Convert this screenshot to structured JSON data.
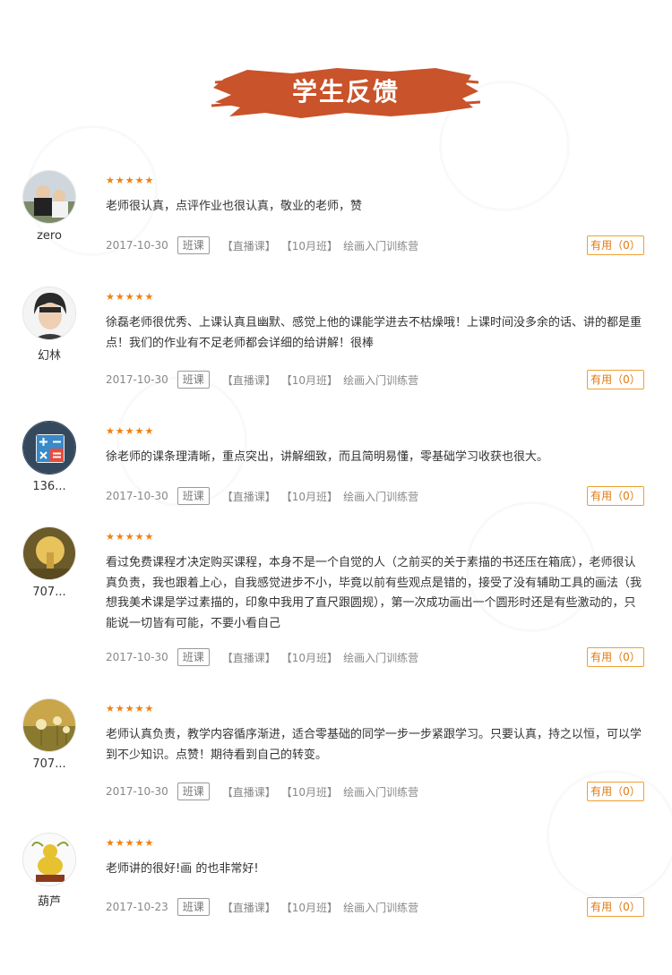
{
  "header": {
    "title": "学生反馈",
    "banner_color": "#c9532a"
  },
  "colors": {
    "star": "#f08010",
    "useful_border": "#f0a030",
    "useful_text": "#e07a10"
  },
  "reviews": [
    {
      "user": "zero",
      "avatar": "photo-couple",
      "stars": "★★★★★",
      "comment": "老师很认真，点评作业也很认真，敬业的老师，赞",
      "date": "2017-10-30",
      "type": "班课",
      "live": "【直播课】",
      "cls": "【10月班】",
      "course": "绘画入门训练营",
      "useful": "有用（0）"
    },
    {
      "user": "幻林",
      "avatar": "photo-portrait",
      "stars": "★★★★★",
      "comment": "徐磊老师很优秀、上课认真且幽默、感觉上他的课能学进去不枯燥哦！上课时间没多余的话、讲的都是重点！我们的作业有不足老师都会详细的给讲解！很棒",
      "date": "2017-10-30",
      "type": "班课",
      "live": "【直播课】",
      "cls": "【10月班】",
      "course": "绘画入门训练营",
      "useful": "有用（0）"
    },
    {
      "user": "136...",
      "avatar": "calculator-icon",
      "stars": "★★★★★",
      "comment": "徐老师的课条理清晰，重点突出，讲解细致，而且简明易懂，零基础学习收获也很大。",
      "date": "2017-10-30",
      "type": "班课",
      "live": "【直播课】",
      "cls": "【10月班】",
      "course": "绘画入门训练营",
      "useful": "有用（0）"
    },
    {
      "user": "707...",
      "avatar": "photo-golden",
      "stars": "★★★★★",
      "comment": "看过免费课程才决定购买课程，本身不是一个自觉的人（之前买的关于素描的书还压在箱底），老师很认真负责，我也跟着上心，自我感觉进步不小，毕竟以前有些观点是错的，接受了没有辅助工具的画法（我想我美术课是学过素描的，印象中我用了直尺跟圆规），第一次成功画出一个圆形时还是有些激动的，只能说一切皆有可能，不要小看自己",
      "date": "2017-10-30",
      "type": "班课",
      "live": "【直播课】",
      "cls": "【10月班】",
      "course": "绘画入门训练营",
      "useful": "有用（0）"
    },
    {
      "user": "707...",
      "avatar": "photo-dandelion",
      "stars": "★★★★★",
      "comment": "老师认真负责，教学内容循序渐进，适合零基础的同学一步一步紧跟学习。只要认真，持之以恒，可以学到不少知识。点赞！期待看到自己的转变。",
      "date": "2017-10-30",
      "type": "班课",
      "live": "【直播课】",
      "cls": "【10月班】",
      "course": "绘画入门训练营",
      "useful": "有用（0）"
    },
    {
      "user": "葫芦",
      "avatar": "photo-gourd",
      "stars": "★★★★★",
      "comment": "老师讲的很好!画 的也非常好!",
      "date": "2017-10-23",
      "type": "班课",
      "live": "【直播课】",
      "cls": "【10月班】",
      "course": "绘画入门训练营",
      "useful": "有用（0）"
    }
  ]
}
